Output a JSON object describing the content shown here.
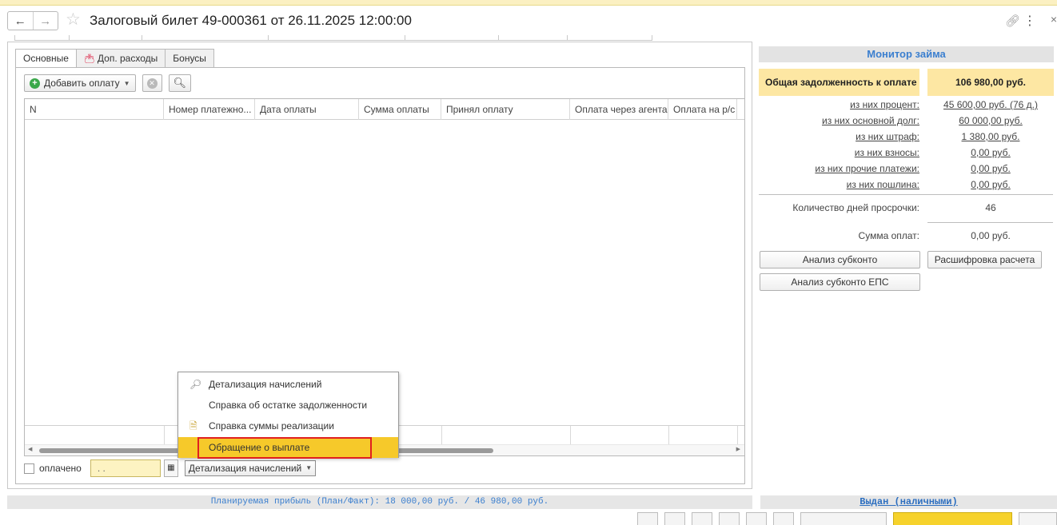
{
  "window": {
    "title": "Залоговый билет 49-000361 от 26.11.2025 12:00:00",
    "back_icon": "←",
    "forward_icon": "→"
  },
  "tabs": [
    {
      "label": "Основные",
      "active": true
    },
    {
      "label": "Доп. расходы",
      "icon": "wallet-icon"
    },
    {
      "label": "Бонусы"
    }
  ],
  "toolbar": {
    "add_payment_label": "Добавить оплату",
    "delete_icon": "delete-icon",
    "find_icon": "find-icon"
  },
  "table": {
    "columns": [
      "N",
      "Номер платежно...",
      "Дата оплаты",
      "Сумма оплаты",
      "Принял оплату",
      "Оплата через агента",
      "Оплата на р/с"
    ],
    "rows": []
  },
  "paid": {
    "checkbox_label": "оплачено",
    "date_value": ". .",
    "details_button_label": "Детализация начислений"
  },
  "popup_menu": {
    "items": [
      {
        "label": "Детализация начислений",
        "icon": "magnifier-icon"
      },
      {
        "label": "Справка об остатке задолженности"
      },
      {
        "label": "Справка суммы реализации",
        "icon": "document-icon"
      },
      {
        "label": "Обращение о выплате",
        "selected": true
      }
    ]
  },
  "monitor": {
    "header": "Монитор займа",
    "total_debt_label": "Общая задолженность к оплате",
    "total_debt_value": "106 980,00 руб.",
    "lines": [
      {
        "label": "из них процент:",
        "value": "45 600,00 руб. (76 д.)"
      },
      {
        "label": "из них основной долг:",
        "value": "60 000,00 руб."
      },
      {
        "label": "из них штраф:",
        "value": "1 380,00 руб."
      },
      {
        "label": "из них взносы:",
        "value": "0,00 руб."
      },
      {
        "label": "из них прочие платежи:",
        "value": "0,00 руб."
      },
      {
        "label": "из них пошлина:",
        "value": "0,00 руб."
      }
    ],
    "overdue_days_label": "Количество дней просрочки:",
    "overdue_days_value": "46",
    "payments_sum_label": "Сумма оплат:",
    "payments_sum_value": "0,00 руб.",
    "button_subconto": "Анализ субконто",
    "button_breakdown": "Расшифровка расчета",
    "button_subconto_eps": "Анализ субконто ЕПС"
  },
  "status": {
    "planned_profit": "Планируемая прибыль (План/Факт): 18 000,00 руб. / 46 980,00 руб.",
    "issued": "Выдан (наличными)"
  },
  "colors": {
    "accent_blue": "#3b7fcf",
    "highlight_yellow": "#f6c92a",
    "debt_bg": "#fde7a3",
    "frame_red": "#e02020"
  }
}
